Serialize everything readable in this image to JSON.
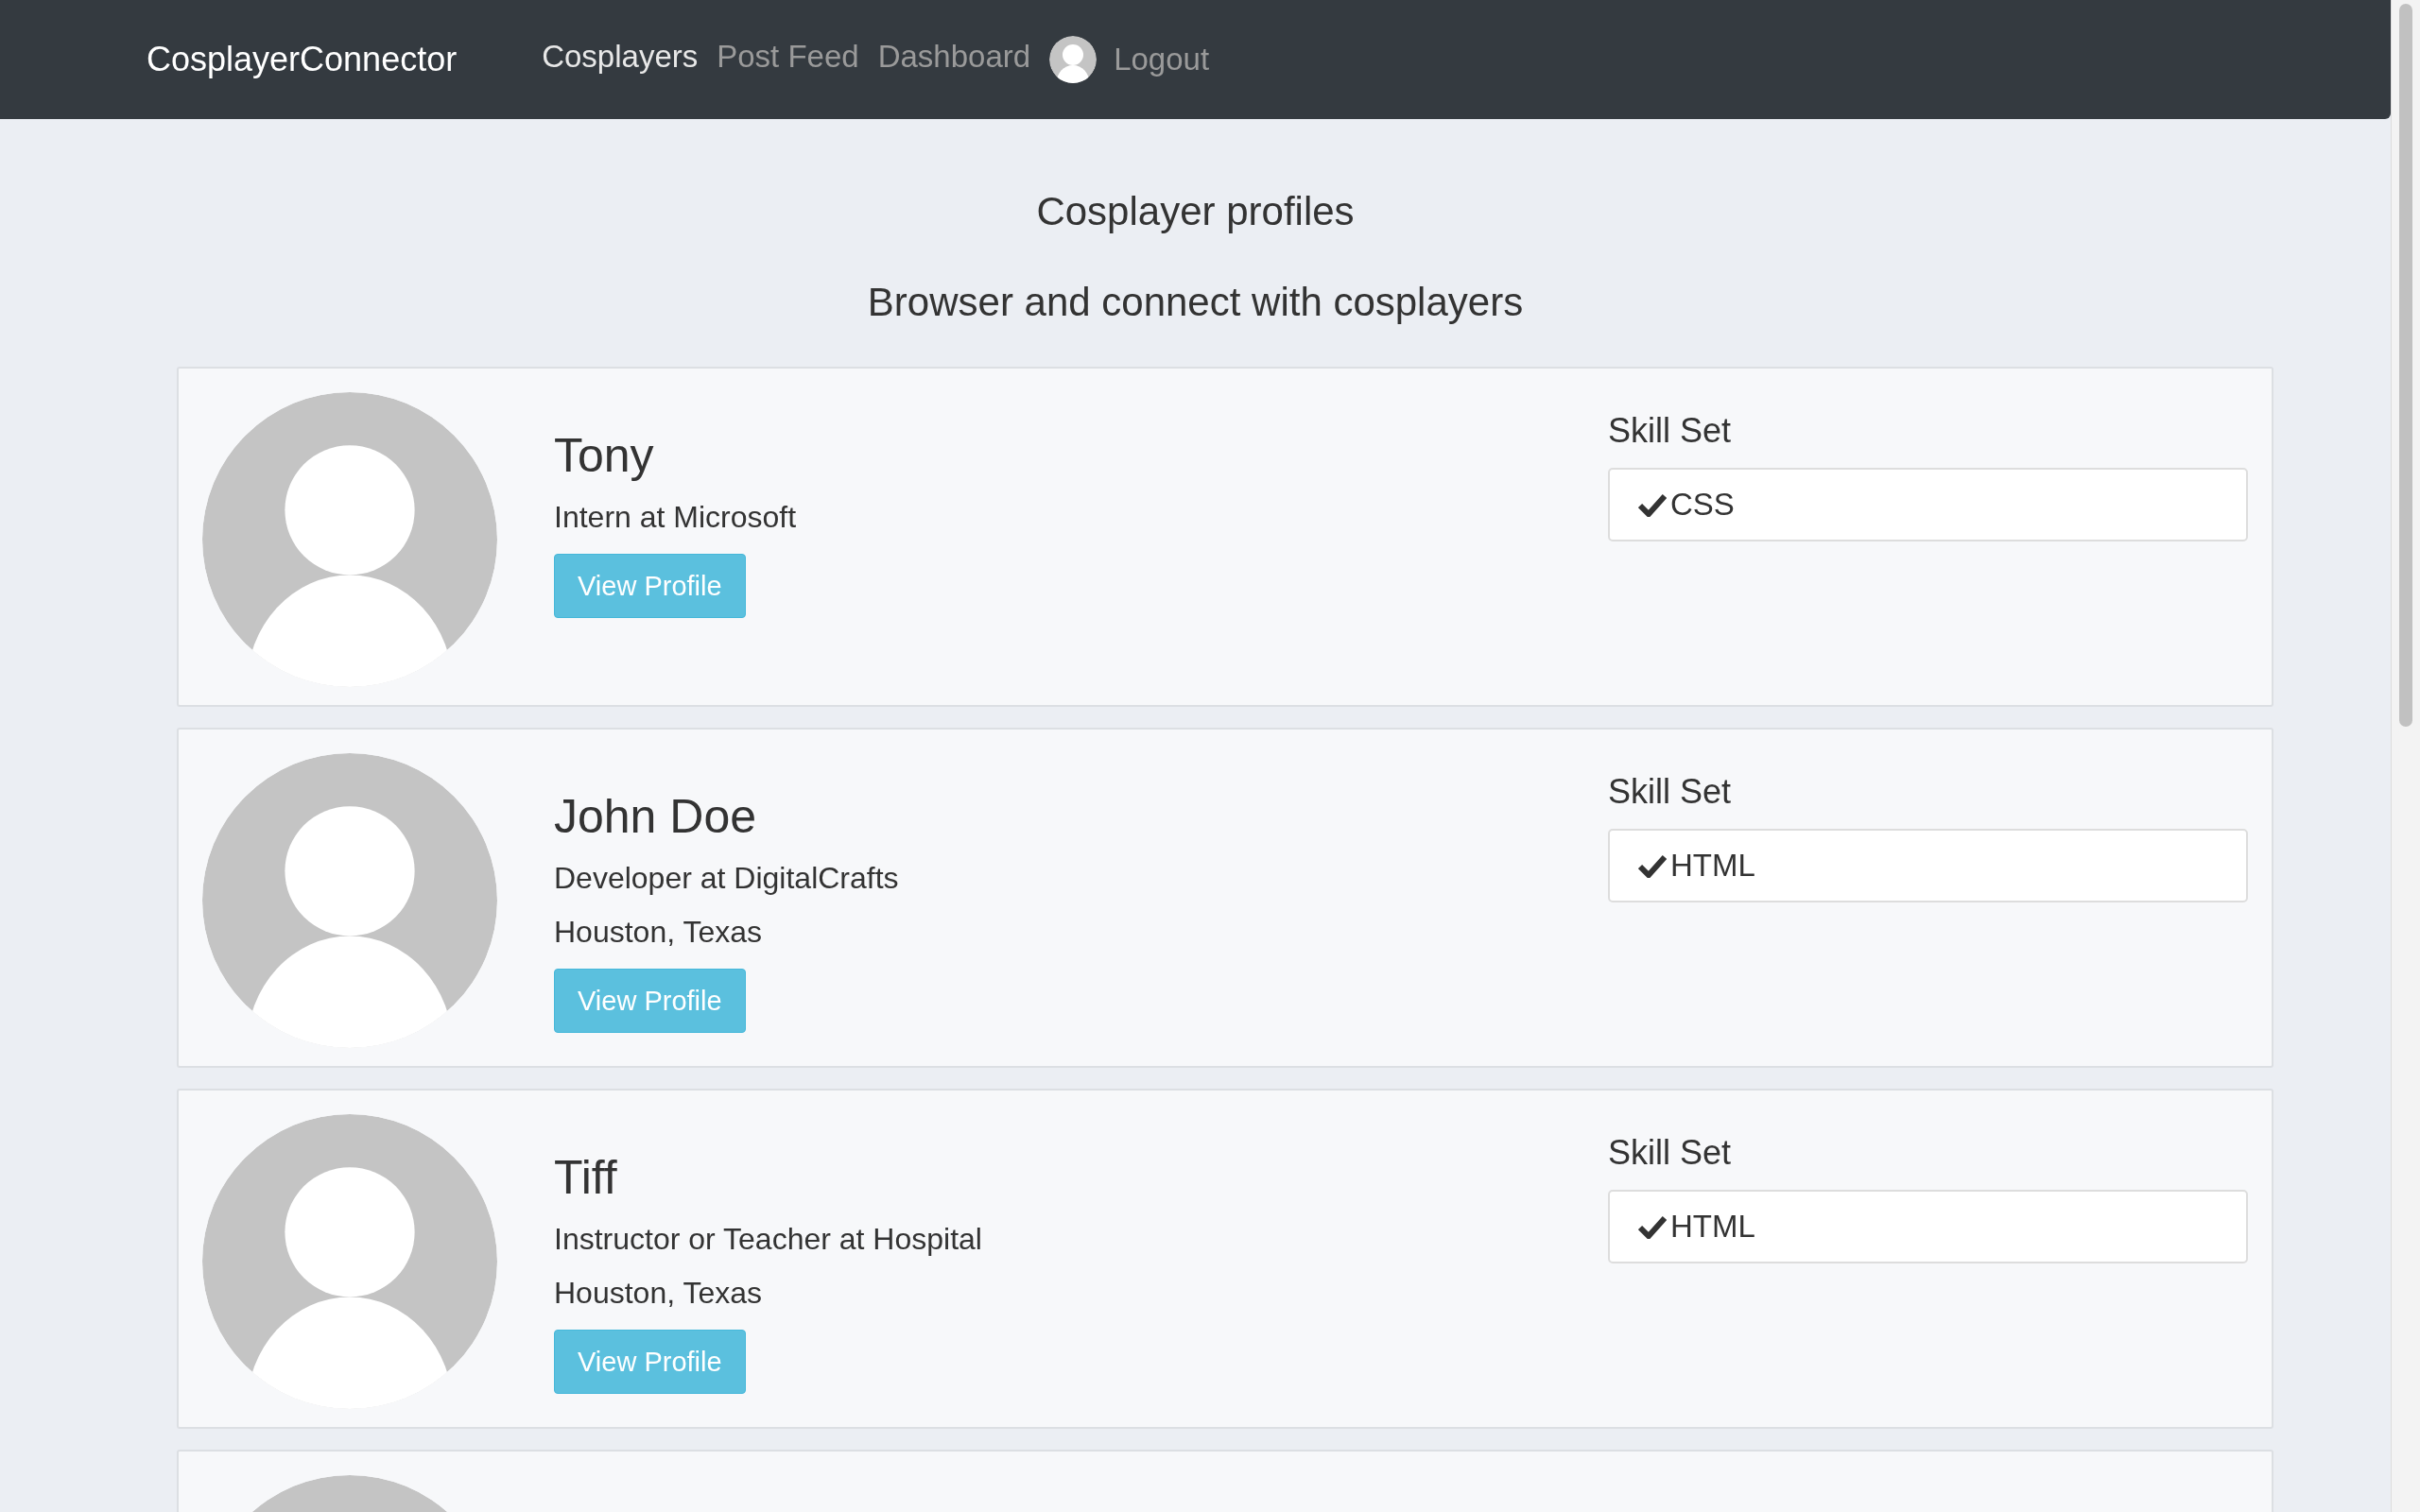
{
  "navbar": {
    "brand": "CosplayerConnector",
    "links": [
      {
        "label": "Cosplayers",
        "selected": true
      },
      {
        "label": "Post Feed",
        "selected": false
      },
      {
        "label": "Dashboard",
        "selected": false
      }
    ],
    "logout": "Logout"
  },
  "header": {
    "title": "Cosplayer profiles",
    "subtitle": "Browser and connect with cosplayers"
  },
  "profiles": [
    {
      "name": "Tony",
      "job": "Intern at Microsoft",
      "button": "View Profile",
      "skill_label": "Skill Set",
      "skills": [
        {
          "label": "CSS",
          "checked": true
        }
      ]
    },
    {
      "name": "John Doe",
      "job": "Developer at DigitalCrafts",
      "location": "Houston, Texas",
      "button": "View Profile",
      "skill_label": "Skill Set",
      "skills": [
        {
          "label": "HTML",
          "checked": true
        }
      ]
    },
    {
      "name": "Tiff",
      "job": "Instructor or Teacher at Hospital",
      "location": "Houston, Texas",
      "button": "View Profile",
      "skill_label": "Skill Set",
      "skills": [
        {
          "label": "HTML",
          "checked": true
        }
      ]
    }
  ]
}
